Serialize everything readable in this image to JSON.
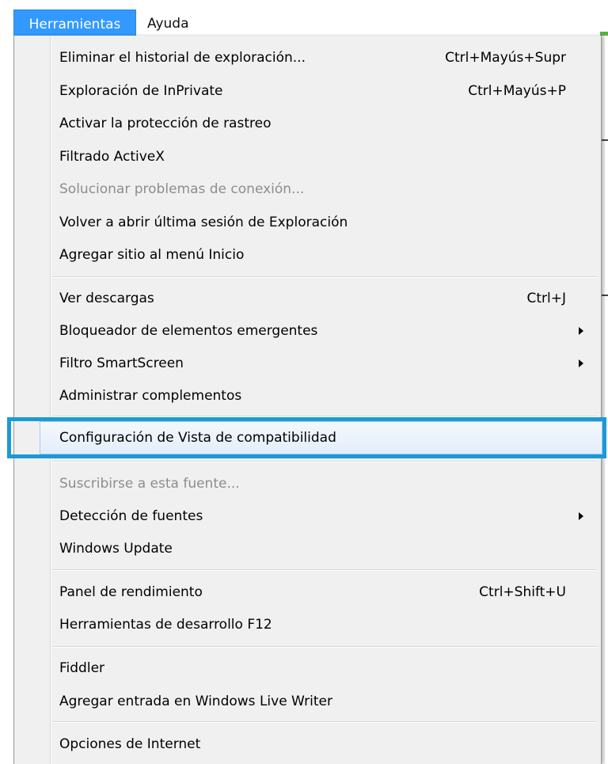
{
  "menubar": {
    "items": [
      {
        "label": "Herramientas"
      },
      {
        "label": "Ayuda"
      }
    ]
  },
  "menu": {
    "items": [
      {
        "label": "Eliminar el historial de exploración...",
        "shortcut": "Ctrl+Mayús+Supr"
      },
      {
        "label": "Exploración de InPrivate",
        "shortcut": "Ctrl+Mayús+P"
      },
      {
        "label": "Activar la protección de rastreo"
      },
      {
        "label": "Filtrado ActiveX"
      },
      {
        "label": "Solucionar problemas de conexión..."
      },
      {
        "label": "Volver a abrir última sesión de Exploración"
      },
      {
        "label": "Agregar sitio al menú Inicio"
      },
      {
        "label": "Ver descargas",
        "shortcut": "Ctrl+J"
      },
      {
        "label": "Bloqueador de elementos emergentes"
      },
      {
        "label": "Filtro SmartScreen"
      },
      {
        "label": "Administrar complementos"
      },
      {
        "label": "Configuración de Vista de compatibilidad"
      },
      {
        "label": "Suscribirse a esta fuente..."
      },
      {
        "label": "Detección de fuentes"
      },
      {
        "label": "Windows Update"
      },
      {
        "label": "Panel de rendimiento",
        "shortcut": "Ctrl+Shift+U"
      },
      {
        "label": "Herramientas de desarrollo F12"
      },
      {
        "label": "Fiddler"
      },
      {
        "label": "Agregar entrada en Windows Live Writer"
      },
      {
        "label": "Opciones de Internet"
      }
    ]
  },
  "colors": {
    "menubar_active": "#3399ff",
    "highlight_border": "#1a9ad6",
    "disabled_text": "#8d8d8d"
  }
}
